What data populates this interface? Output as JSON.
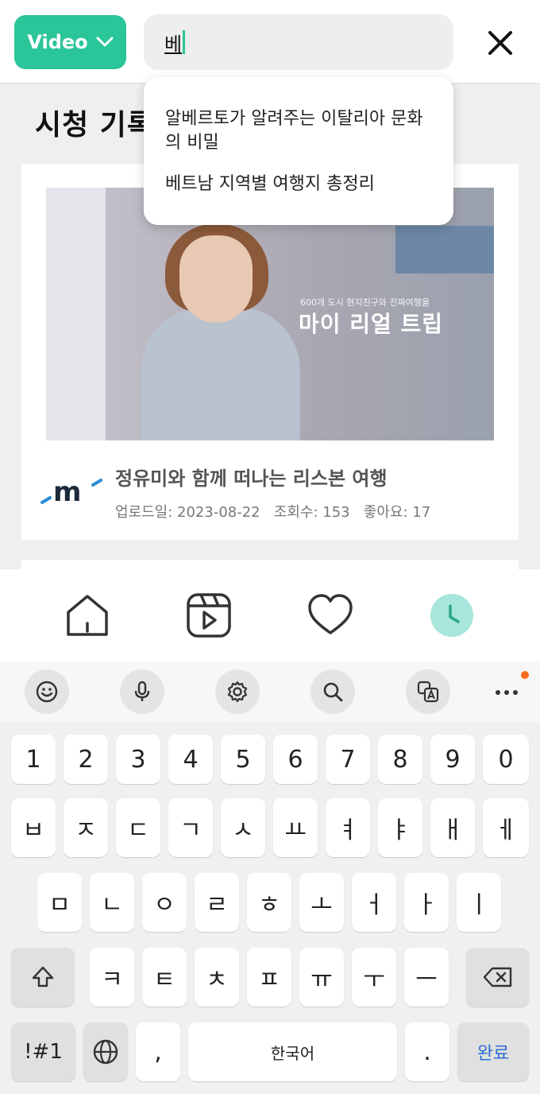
{
  "header": {
    "type_button_label": "Video",
    "search_value": "베",
    "close_label": "close"
  },
  "suggestions": [
    "알베르토가 알려주는 이탈리아 문화의 비밀",
    "베트남 지역별 여행지 총정리"
  ],
  "page": {
    "title": "시청 기록"
  },
  "video_card": {
    "thumbnail_subtitle": "600개 도시 현지친구와 진짜여행을",
    "thumbnail_title": "마이 리얼 트립",
    "title": "정유미와 함께 떠나는 리스본 여행",
    "meta": "업로드일: 2023-08-22   조회수: 153   좋아요: 17"
  },
  "bottom_nav": {
    "items": [
      "home-icon",
      "reels-icon",
      "heart-icon",
      "history-icon"
    ],
    "active": "history-icon",
    "active_color": "#a8e6dc"
  },
  "keyboard": {
    "toolbar": [
      "emoji-icon",
      "mic-icon",
      "gear-icon",
      "search-icon",
      "translate-icon",
      "more-icon"
    ],
    "row_numbers": [
      "1",
      "2",
      "3",
      "4",
      "5",
      "6",
      "7",
      "8",
      "9",
      "0"
    ],
    "row_1": [
      "ㅂ",
      "ㅈ",
      "ㄷ",
      "ㄱ",
      "ㅅ",
      "ㅛ",
      "ㅕ",
      "ㅑ",
      "ㅐ",
      "ㅔ"
    ],
    "row_2": [
      "ㅁ",
      "ㄴ",
      "ㅇ",
      "ㄹ",
      "ㅎ",
      "ㅗ",
      "ㅓ",
      "ㅏ",
      "ㅣ"
    ],
    "row_3": [
      "ㅋ",
      "ㅌ",
      "ㅊ",
      "ㅍ",
      "ㅠ",
      "ㅜ",
      "ㅡ"
    ],
    "symbols_label": "!#1",
    "comma_label": ",",
    "space_label": "한국어",
    "period_label": ".",
    "done_label": "완료"
  },
  "colors": {
    "accent": "#2bc59a",
    "done_text": "#2b6fd6",
    "notify_dot": "#ff6a1a"
  }
}
